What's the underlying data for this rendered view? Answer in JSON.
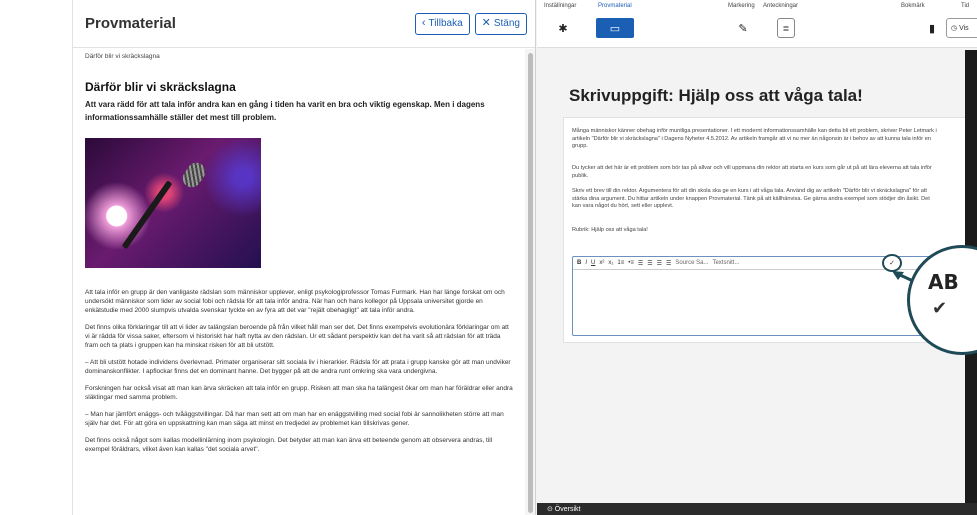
{
  "reader": {
    "title": "Provmaterial",
    "back_label": "Tillbaka",
    "close_label": "Stäng",
    "breadcrumb": "Därför blir vi skräckslagna",
    "article_title": "Därför blir vi skräckslagna",
    "lead": "Att vara rädd för att tala inför andra kan en gång i tiden ha varit en bra och viktig egenskap. Men i dagens informationssamhälle ställer det mest till problem.",
    "paragraphs": [
      "Att tala inför en grupp är den vanligaste rädslan som människor upplever, enligt psykologiprofessor Tomas Furmark. Han har länge forskat om och undersökt människor som lider av social fobi och rädsla för att tala inför andra. När han och hans kollegor på Uppsala universitet gjorde en enkätstudie med 2000 slumpvis utvalda svenskar tyckte en av fyra att det var \"rejält obehagligt\" att tala inför andra.",
      "Det finns olika förklaringar till att vi lider av talängslan beroende på från vilket håll man ser det. Det finns exempelvis evolutionära förklaringar om att vi är rädda för vissa saker, eftersom vi historiskt har haft nytta av den rädslan. Ur ett sådant perspektiv kan det ha varit så att rädslan för att träda fram och ta plats i gruppen kan ha minskat risken för att bli utstött.",
      "– Att bli utstött hotade individens överlevnad. Primater organiserar sitt sociala liv i hierarkier. Rädsla för att prata i grupp kanske gör att man undviker dominanskonflikter. I apflockar finns det en dominant hanne. Det bygger på att de andra runt omkring ska vara undergivna.",
      "Forskningen har också visat att man kan ärva skräcken att tala inför en grupp. Risken att man ska ha talängest ökar om man har föräldrar eller andra släktingar med samma problem.",
      "– Man har jämfört enäggs- och tvåäggstvillingar. Då har man sett att om man har en enäggstvilling med social fobi är sannolikheten större att man själv har det. För att göra en uppskattning kan man säga att minst en tredjedel av problemet kan tillskrivas gener.",
      "Det finns också något som kallas modellinlärning inom psykologin. Det betyder att man kan ärva ett beteende genom att observera andras, till exempel föräldrars, vilket även kan kallas \"det sociala arvet\"."
    ]
  },
  "toolbar": {
    "settings_label": "Inställningar",
    "material_label": "Provmaterial",
    "marking_label": "Markering",
    "notes_label": "Anteckningar",
    "bookmark_label": "Bokmärk",
    "time_label": "Tid",
    "time_button": "Vis"
  },
  "task": {
    "title": "Skrivuppgift: Hjälp oss att våga tala!",
    "p1": "Många människor känner obehag inför muntliga presentationer. I ett modernt informationssamhälle kan detta bli ett problem, skriver Peter Letmark i artikeln \"Därför blir vi skräckslagna\" i Dagens Nyheter 4.5.2012. Av artikeln framgår att vi nu mer än någonsin är i behov av att kunna tala inför en grupp.",
    "p2": "Du tycker att det här är ett problem som bör tas på allvar och vill uppmana din rektor att starta en kurs som går ut på att lära eleverna att tala inför publik.",
    "p3": "Skriv ett brev till din rektor. Argumentera för att din skola ska ge en kurs i att våga tala. Använd dig av artikeln \"Därför blir vi skräckslagna\" för att stärka dina argument. Du hittar artikeln under knappen Provmaterial. Tänk på att källhänvisa. Ge gärna andra exempel som stödjer din åsikt. Det kan vara något du hört, sett eller upplevt.",
    "p4": "Rubrik: Hjälp oss att våga tala!",
    "editor": {
      "bold": "B",
      "italic": "I",
      "underline": "U",
      "sup": "x²",
      "sub": "x₁",
      "ol": "1≡",
      "ul": "•≡",
      "source": "Source Sa...",
      "size": "Textsnitt...",
      "spell": "ABC"
    }
  },
  "zoom": {
    "text": "AB",
    "check": "✔"
  },
  "bottombar": {
    "left": "⊙ Översikt"
  }
}
